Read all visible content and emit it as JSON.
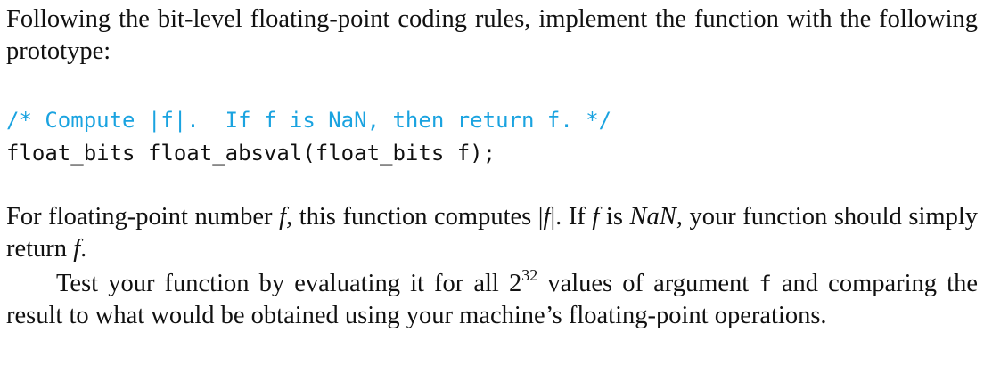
{
  "intro": {
    "text": "Following the bit-level floating-point coding rules, implement the function with the following prototype:"
  },
  "code": {
    "comment_line": "/* Compute |f|.  If f is NaN, then return f. */",
    "decl_line": "float_bits float_absval(float_bits f);"
  },
  "paragraph1": {
    "p1": "For floating-point number ",
    "f1": "f",
    "p2": ", this function computes |",
    "f2": "f",
    "p3": "|. If ",
    "f3": "f",
    "p4": " is ",
    "nan": "NaN",
    "p5": ", your function should simply return ",
    "f4": "f",
    "p6": "."
  },
  "paragraph2": {
    "p1": "Test your function by evaluating it for all 2",
    "exp": "32",
    "p2": " values of argument ",
    "arg": "f",
    "p3": " and comparing the result to what would be obtained using your machine’s floating-point operations."
  }
}
